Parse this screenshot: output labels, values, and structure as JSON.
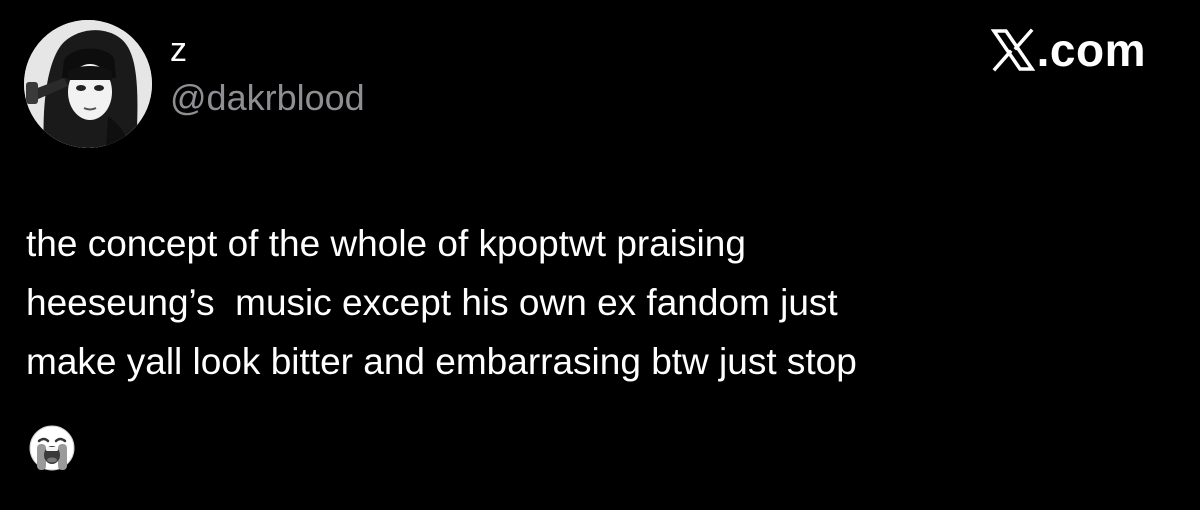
{
  "author": {
    "display_name": "z",
    "handle": "@dakrblood"
  },
  "brand": {
    "icon": "x-logo-icon",
    "domain": ".com"
  },
  "tweet": {
    "lines": [
      "the concept of the whole of kpoptwt praising",
      "heeseung’s  music except his own ex fandom just",
      "make yall look bitter and embarrasing btw just stop"
    ],
    "emoji": "loudly-crying-face"
  },
  "colors": {
    "background": "#000000",
    "text_primary": "#ffffff",
    "text_secondary": "#8e8e93"
  }
}
